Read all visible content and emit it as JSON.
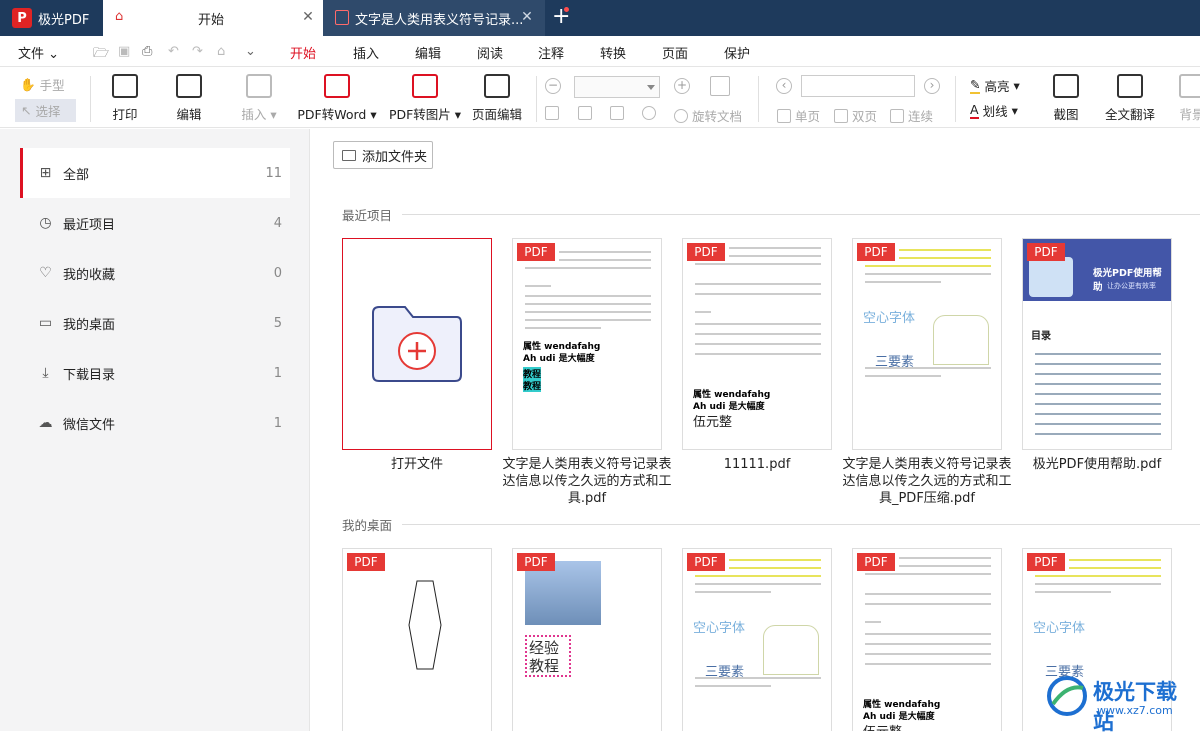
{
  "app": {
    "name": "极光PDF",
    "logo_letter": "P"
  },
  "tabs": [
    {
      "label": "开始",
      "close": "✕"
    },
    {
      "label": "文字是人类用表义符号记录...",
      "close": "✕"
    }
  ],
  "menu": {
    "file": "文件",
    "items": [
      "开始",
      "插入",
      "编辑",
      "阅读",
      "注释",
      "转换",
      "页面",
      "保护"
    ]
  },
  "ribbon": {
    "hand": "手型",
    "select": "选择",
    "print": "打印",
    "edit": "编辑",
    "insert": "插入",
    "pdf2word": "PDF转Word",
    "pdf2img": "PDF转图片",
    "page_edit": "页面编辑",
    "rotate": "旋转文档",
    "single": "单页",
    "double": "双页",
    "continuous": "连续",
    "highlight": "高亮",
    "underline": "划线",
    "screenshot": "截图",
    "translate": "全文翻译",
    "background": "背景"
  },
  "sidebar": [
    {
      "label": "全部",
      "count": "11",
      "icon": "grid-icon"
    },
    {
      "label": "最近项目",
      "count": "4",
      "icon": "clock-icon"
    },
    {
      "label": "我的收藏",
      "count": "0",
      "icon": "heart-icon"
    },
    {
      "label": "我的桌面",
      "count": "5",
      "icon": "monitor-icon"
    },
    {
      "label": "下载目录",
      "count": "1",
      "icon": "download-icon"
    },
    {
      "label": "微信文件",
      "count": "1",
      "icon": "wechat-icon"
    }
  ],
  "main": {
    "add_folder": "添加文件夹",
    "recent_title": "最近项目",
    "desktop_title": "我的桌面",
    "pdf_badge": "PDF",
    "recent": [
      {
        "caption": "打开文件"
      },
      {
        "caption": "文字是人类用表义符号记录表达信息以传之久远的方式和工具.pdf"
      },
      {
        "caption": "11111.pdf"
      },
      {
        "caption": "文字是人类用表义符号记录表达信息以传之久远的方式和工具_PDF压缩.pdf"
      },
      {
        "caption": "极光PDF使用帮助.pdf"
      }
    ],
    "thumb_text": {
      "attr": "属性 wendafahg",
      "ahudi": "Ah udi 是大幅度",
      "jiaocheng": "教程",
      "wuyuan": "伍元整",
      "kongxin": "空心字体",
      "sanyaosu": "三要素",
      "jingyan": "经验",
      "jiaocheng2": "教程",
      "help_title": "极光PDF使用帮助",
      "help_sub": "让办公更有效率",
      "mulu": "目录"
    }
  },
  "watermark": {
    "text": "极光下载站",
    "url": "www.xz7.com"
  }
}
